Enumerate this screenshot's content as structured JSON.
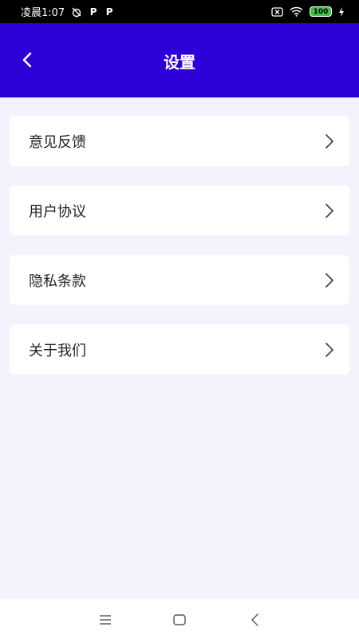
{
  "status_bar": {
    "time": "凌晨1:07",
    "p1": "P",
    "p2": "P",
    "battery": "100"
  },
  "header": {
    "title": "设置",
    "back_icon": "chevron-left-icon"
  },
  "menu": {
    "items": [
      {
        "label": "意见反馈",
        "icon": "chevron-right-icon"
      },
      {
        "label": "用户协议",
        "icon": "chevron-right-icon"
      },
      {
        "label": "隐私条款",
        "icon": "chevron-right-icon"
      },
      {
        "label": "关于我们",
        "icon": "chevron-right-icon"
      }
    ]
  },
  "nav_bar": {
    "menu_icon": "menu-icon",
    "home_icon": "home-icon",
    "back_icon": "back-icon"
  },
  "colors": {
    "header_bg": "#2e00d8",
    "page_bg": "#f4f3fd",
    "battery": "#3ec24b"
  }
}
